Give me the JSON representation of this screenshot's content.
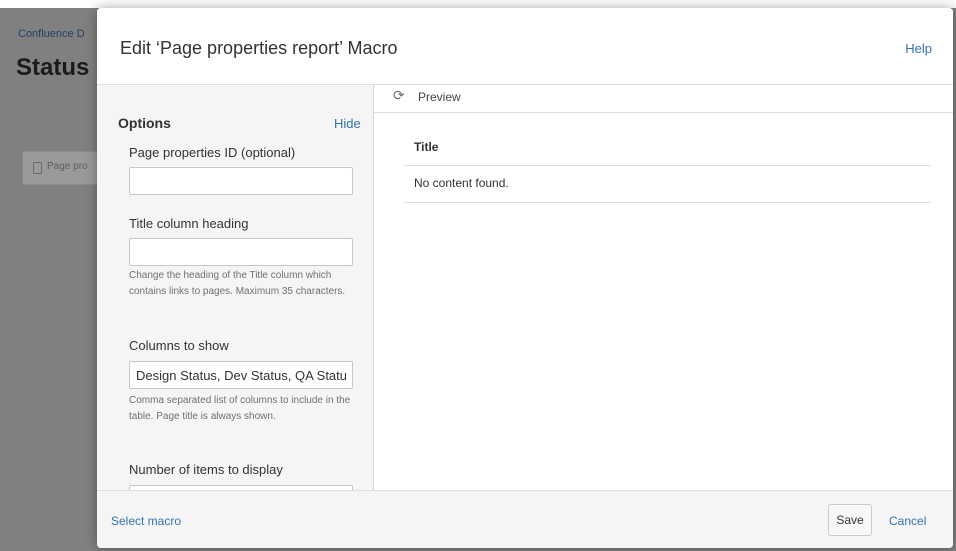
{
  "background_page": {
    "breadcrumb": "Confluence D",
    "title": "Status",
    "chip_label": "Page pro"
  },
  "dialog": {
    "title": "Edit ‘Page properties report’ Macro",
    "help_label": "Help"
  },
  "options": {
    "heading": "Options",
    "hide_label": "Hide",
    "fields": {
      "page_properties_id": {
        "label": "Page properties ID (optional)",
        "value": "",
        "placeholder": ""
      },
      "title_column_heading": {
        "label": "Title column heading",
        "value": "",
        "placeholder": "",
        "help": "Change the heading of the Title column which contains links to pages. Maximum 35 characters."
      },
      "columns_to_show": {
        "label": "Columns to show",
        "value": "Design Status, Dev Status, QA Status",
        "help": "Comma separated list of columns to include in the table. Page title is always shown."
      },
      "number_of_items": {
        "label": "Number of items to display",
        "value": ""
      }
    }
  },
  "preview": {
    "label": "Preview",
    "icon": "refresh-icon",
    "table": {
      "column_header": "Title",
      "empty_message": "No content found."
    }
  },
  "footer": {
    "select_macro_label": "Select macro",
    "save_label": "Save",
    "cancel_label": "Cancel"
  },
  "colors": {
    "link": "#3572b0",
    "backdrop": "#808080",
    "panel_bg": "#f5f5f5"
  }
}
